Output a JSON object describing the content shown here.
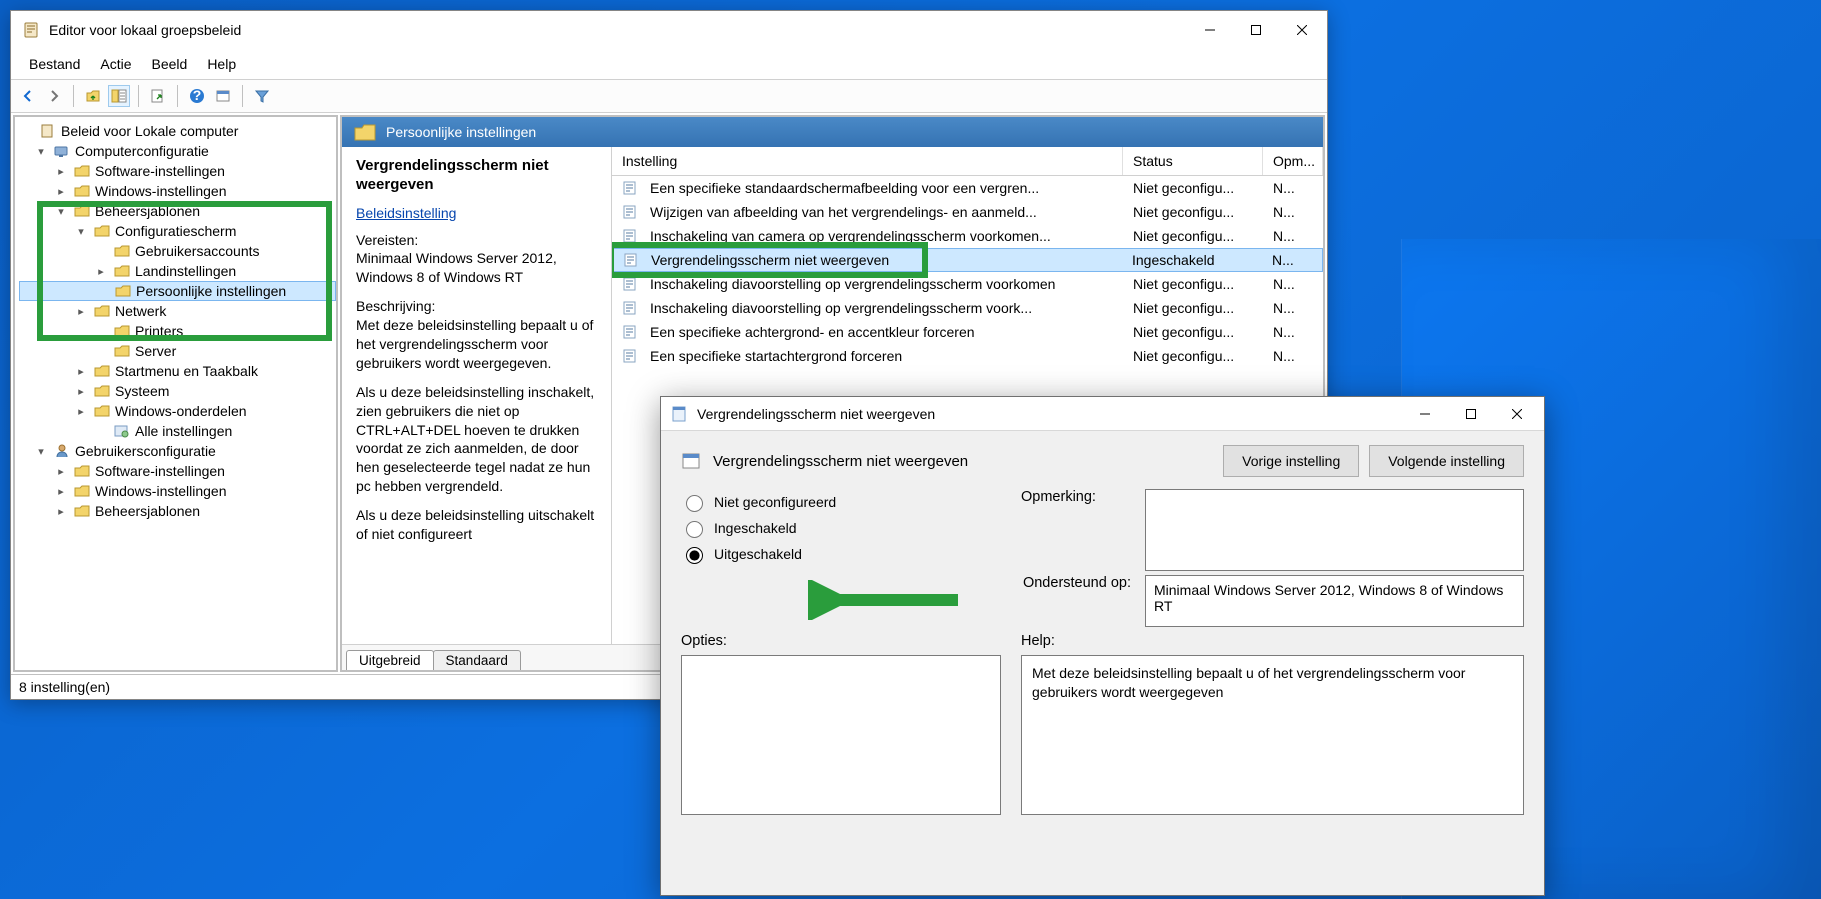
{
  "titlebar": {
    "title": "Editor voor lokaal groepsbeleid"
  },
  "menubar": [
    "Bestand",
    "Actie",
    "Beeld",
    "Help"
  ],
  "toolbar_icons": [
    "back",
    "forward",
    "up",
    "tree-list",
    "export",
    "help",
    "properties",
    "filter"
  ],
  "tree": {
    "root": "Beleid voor Lokale computer",
    "computerconfig": "Computerconfiguratie",
    "software1": "Software-instellingen",
    "windows1": "Windows-instellingen",
    "beheersjablonen": "Beheersjablonen",
    "config": "Configuratiescherm",
    "gebruikers": "Gebruikersaccounts",
    "land": "Landinstellingen",
    "persoonlijke": "Persoonlijke instellingen",
    "netwerk": "Netwerk",
    "printers": "Printers",
    "server": "Server",
    "startmenu": "Startmenu en Taakbalk",
    "systeem": "Systeem",
    "windowsond": "Windows-onderdelen",
    "alle": "Alle instellingen",
    "gebruikersconfig": "Gebruikersconfiguratie",
    "software2": "Software-instellingen",
    "windows2": "Windows-instellingen",
    "beheersjablonen2": "Beheersjablonen"
  },
  "content": {
    "header": "Persoonlijke instellingen",
    "selected_title": "Vergrendelingsscherm niet weergeven",
    "beleidsinstelling_link": "Beleidsinstelling",
    "vereisten_label": "Vereisten:",
    "vereisten": "Minimaal Windows Server 2012, Windows 8 of Windows RT",
    "beschrijving_label": "Beschrijving:",
    "beschrijving_p1": "Met deze beleidsinstelling bepaalt u of het vergrendelingsscherm voor gebruikers wordt weergegeven.",
    "beschrijving_p2": "Als u deze beleidsinstelling inschakelt, zien gebruikers die niet op CTRL+ALT+DEL hoeven te drukken voordat ze zich aanmelden, de door hen geselecteerde tegel nadat ze hun pc hebben vergrendeld.",
    "beschrijving_p3": "Als u deze beleidsinstelling uitschakelt of niet configureert",
    "columns": {
      "instelling": "Instelling",
      "status": "Status",
      "opm": "Opm..."
    },
    "items": [
      {
        "name": "Een specifieke standaardschermafbeelding voor een vergren...",
        "status": "Niet geconfigu...",
        "opm": "N..."
      },
      {
        "name": "Wijzigen van afbeelding van het vergrendelings- en aanmeld...",
        "status": "Niet geconfigu...",
        "opm": "N..."
      },
      {
        "name": "Inschakeling van camera op vergrendelingsscherm voorkomen...",
        "status": "Niet geconfigu...",
        "opm": "N..."
      },
      {
        "name": "Vergrendelingsscherm niet weergeven",
        "status": "Ingeschakeld",
        "opm": "N...",
        "selected": true
      },
      {
        "name": "Inschakeling diavoorstelling op vergrendelingsscherm voorkomen",
        "status": "Niet geconfigu...",
        "opm": "N..."
      },
      {
        "name": "Inschakeling diavoorstelling op vergrendelingsscherm voork...",
        "status": "Niet geconfigu...",
        "opm": "N..."
      },
      {
        "name": "Een specifieke achtergrond- en accentkleur forceren",
        "status": "Niet geconfigu...",
        "opm": "N..."
      },
      {
        "name": "Een specifieke startachtergrond forceren",
        "status": "Niet geconfigu...",
        "opm": "N..."
      }
    ],
    "tabs": {
      "uitgebreid": "Uitgebreid",
      "standaard": "Standaard"
    }
  },
  "statusbar": "8 instelling(en)",
  "dialog": {
    "title": "Vergrendelingsscherm niet weergeven",
    "header_label": "Vergrendelingsscherm niet weergeven",
    "prev_button": "Vorige instelling",
    "next_button": "Volgende instelling",
    "radio_notconfigured": "Niet geconfigureerd",
    "radio_enabled": "Ingeschakeld",
    "radio_disabled": "Uitgeschakeld",
    "opmerking_label": "Opmerking:",
    "ondersteund_label": "Ondersteund op:",
    "ondersteund_value": "Minimaal Windows Server 2012, Windows 8 of Windows RT",
    "opties_label": "Opties:",
    "help_label": "Help:",
    "help_text": "Met deze beleidsinstelling bepaalt u of het vergrendelingsscherm voor gebruikers wordt weergegeven"
  }
}
